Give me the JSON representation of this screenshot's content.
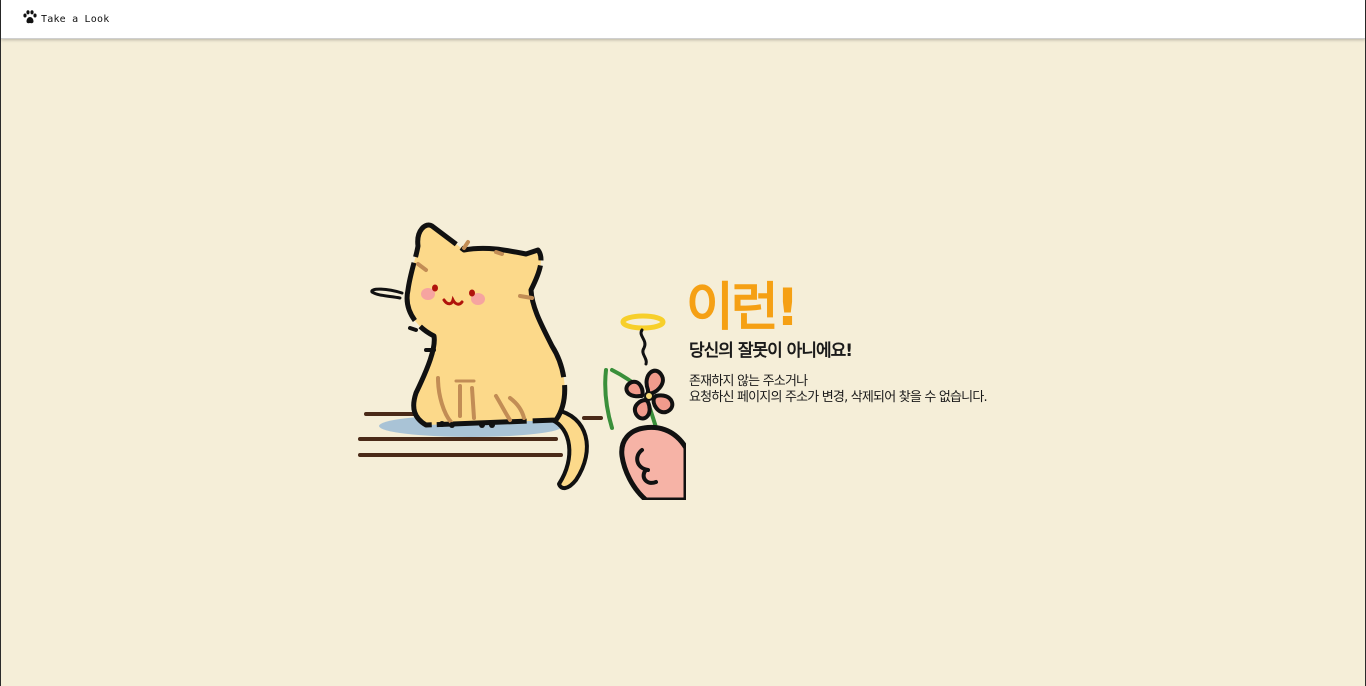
{
  "header": {
    "logo_text": "Take a Look",
    "logo_icon": "paw-icon"
  },
  "error": {
    "headline": "이런!",
    "subtitle": "당신의 잘못이 아니에요!",
    "description_line1": "존재하지 않는 주소거나",
    "description_line2": "요청하신 페이지의 주소가 변경, 삭제되어 찾을 수 없습니다."
  },
  "illustration": {
    "icon": "cat-with-flower-illustration"
  },
  "colors": {
    "background": "#f5eed8",
    "header_background": "#ffffff",
    "headline": "#f5a014",
    "text": "#1a1a1a",
    "cat_fill": "#fcd98a"
  }
}
